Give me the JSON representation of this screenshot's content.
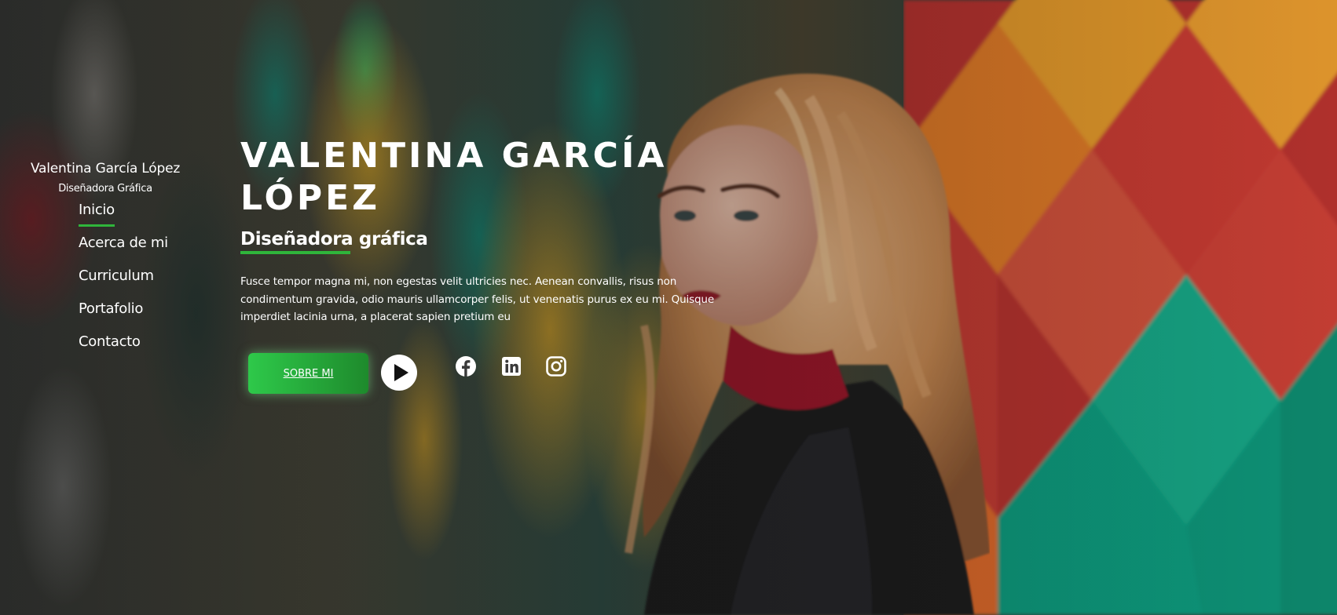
{
  "site": {
    "name": "Valentina García López",
    "role": "Diseñadora Gráfica"
  },
  "nav": {
    "items": [
      {
        "label": "Inicio",
        "active": true
      },
      {
        "label": "Acerca de mi",
        "active": false
      },
      {
        "label": "Curriculum",
        "active": false
      },
      {
        "label": "Portafolio",
        "active": false
      },
      {
        "label": "Contacto",
        "active": false
      }
    ]
  },
  "hero": {
    "title": "Valentina García López",
    "subtitle": "Diseñadora gráfica",
    "description": "Fusce tempor magna mi, non egestas velit ultricies nec. Aenean convallis, risus non condimentum gravida, odio mauris ullamcorper felis, ut venenatis purus ex eu mi. Quisque imperdiet lacinia urna, a placerat sapien pretium eu",
    "cta_label": "SOBRE MI"
  },
  "social": {
    "icons": [
      "facebook-icon",
      "linkedin-icon",
      "instagram-icon"
    ]
  },
  "colors": {
    "accent": "#2fb53b",
    "button_start": "#2ec94a",
    "button_end": "#1e8a2c",
    "text": "#ffffff"
  }
}
